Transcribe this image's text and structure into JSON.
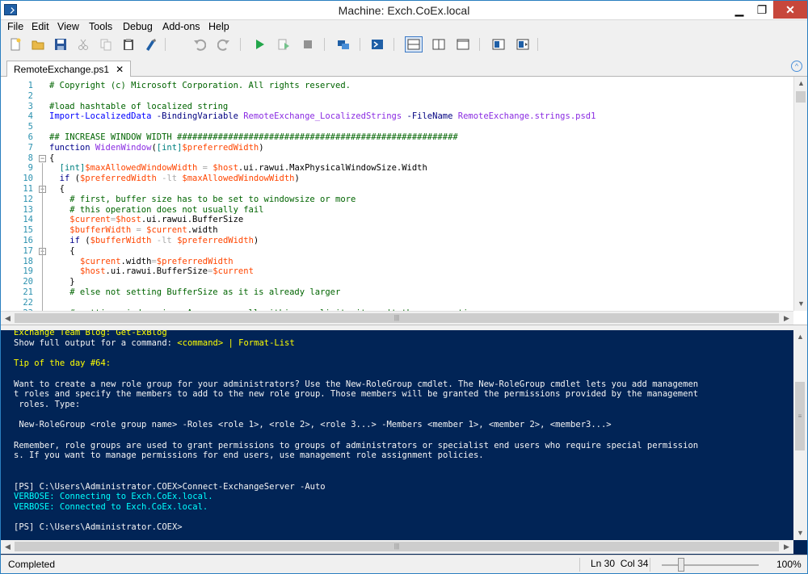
{
  "window": {
    "title": "Machine: Exch.CoEx.local",
    "minimize": "▁",
    "maximize": "❐",
    "close": "✕"
  },
  "menu": [
    "File",
    "Edit",
    "View",
    "Tools",
    "Debug",
    "Add-ons",
    "Help"
  ],
  "toolbar": {
    "icons": [
      "new-icon",
      "open-icon",
      "save-icon",
      "cut-icon",
      "copy-icon",
      "paste-icon",
      "clear-console-icon",
      "undo-icon",
      "redo-icon",
      "run-icon",
      "run-selection-icon",
      "stop-icon",
      "remote-session-icon",
      "powershell-icon",
      "layout-top-icon",
      "layout-right-icon",
      "layout-max-icon",
      "show-script-icon",
      "show-commands-icon"
    ]
  },
  "tab": {
    "label": "RemoteExchange.ps1",
    "close": "✕",
    "collapse": "^"
  },
  "editor": {
    "lines": [
      {
        "n": "1",
        "tokens": [
          {
            "c": "cm",
            "t": "# Copyright (c) Microsoft Corporation. All rights reserved."
          }
        ]
      },
      {
        "n": "2",
        "tokens": []
      },
      {
        "n": "3",
        "tokens": [
          {
            "c": "cm",
            "t": "#load hashtable of localized string"
          }
        ]
      },
      {
        "n": "4",
        "tokens": [
          {
            "c": "cmd",
            "t": "Import-LocalizedData"
          },
          {
            "c": "prm",
            "t": " -BindingVariable "
          },
          {
            "c": "str",
            "t": "RemoteExchange_LocalizedStrings"
          },
          {
            "c": "prm",
            "t": " -FileName "
          },
          {
            "c": "str",
            "t": "RemoteExchange.strings.psd1"
          }
        ]
      },
      {
        "n": "5",
        "tokens": []
      },
      {
        "n": "6",
        "tokens": [
          {
            "c": "cm",
            "t": "## INCREASE WINDOW WIDTH #######################################################"
          }
        ]
      },
      {
        "n": "7",
        "tokens": [
          {
            "c": "kw",
            "t": "function"
          },
          {
            "c": "plain",
            "t": " "
          },
          {
            "c": "str",
            "t": "WidenWindow"
          },
          {
            "c": "plain",
            "t": "("
          },
          {
            "c": "type",
            "t": "[int]"
          },
          {
            "c": "var",
            "t": "$preferredWidth"
          },
          {
            "c": "plain",
            "t": ")"
          }
        ]
      },
      {
        "n": "8",
        "tokens": [
          {
            "c": "plain",
            "t": "{"
          }
        ]
      },
      {
        "n": "9",
        "tokens": [
          {
            "c": "plain",
            "t": "  "
          },
          {
            "c": "type",
            "t": "[int]"
          },
          {
            "c": "var",
            "t": "$maxAllowedWindowWidth"
          },
          {
            "c": "op",
            "t": " = "
          },
          {
            "c": "var",
            "t": "$host"
          },
          {
            "c": "plain",
            "t": ".ui.rawui.MaxPhysicalWindowSize.Width"
          }
        ]
      },
      {
        "n": "10",
        "tokens": [
          {
            "c": "plain",
            "t": "  "
          },
          {
            "c": "kw",
            "t": "if"
          },
          {
            "c": "plain",
            "t": " ("
          },
          {
            "c": "var",
            "t": "$preferredWidth"
          },
          {
            "c": "op",
            "t": " -lt "
          },
          {
            "c": "var",
            "t": "$maxAllowedWindowWidth"
          },
          {
            "c": "plain",
            "t": ")"
          }
        ]
      },
      {
        "n": "11",
        "tokens": [
          {
            "c": "plain",
            "t": "  {"
          }
        ]
      },
      {
        "n": "12",
        "tokens": [
          {
            "c": "cm",
            "t": "    # first, buffer size has to be set to windowsize or more"
          }
        ]
      },
      {
        "n": "13",
        "tokens": [
          {
            "c": "cm",
            "t": "    # this operation does not usually fail"
          }
        ]
      },
      {
        "n": "14",
        "tokens": [
          {
            "c": "plain",
            "t": "    "
          },
          {
            "c": "var",
            "t": "$current"
          },
          {
            "c": "op",
            "t": "="
          },
          {
            "c": "var",
            "t": "$host"
          },
          {
            "c": "plain",
            "t": ".ui.rawui.BufferSize"
          }
        ]
      },
      {
        "n": "15",
        "tokens": [
          {
            "c": "plain",
            "t": "    "
          },
          {
            "c": "var",
            "t": "$bufferWidth"
          },
          {
            "c": "op",
            "t": " = "
          },
          {
            "c": "var",
            "t": "$current"
          },
          {
            "c": "plain",
            "t": ".width"
          }
        ]
      },
      {
        "n": "16",
        "tokens": [
          {
            "c": "plain",
            "t": "    "
          },
          {
            "c": "kw",
            "t": "if"
          },
          {
            "c": "plain",
            "t": " ("
          },
          {
            "c": "var",
            "t": "$bufferWidth"
          },
          {
            "c": "op",
            "t": " -lt "
          },
          {
            "c": "var",
            "t": "$preferredWidth"
          },
          {
            "c": "plain",
            "t": ")"
          }
        ]
      },
      {
        "n": "17",
        "tokens": [
          {
            "c": "plain",
            "t": "    {"
          }
        ]
      },
      {
        "n": "18",
        "tokens": [
          {
            "c": "plain",
            "t": "      "
          },
          {
            "c": "var",
            "t": "$current"
          },
          {
            "c": "plain",
            "t": ".width"
          },
          {
            "c": "op",
            "t": "="
          },
          {
            "c": "var",
            "t": "$preferredWidth"
          }
        ]
      },
      {
        "n": "19",
        "tokens": [
          {
            "c": "plain",
            "t": "      "
          },
          {
            "c": "var",
            "t": "$host"
          },
          {
            "c": "plain",
            "t": ".ui.rawui.BufferSize"
          },
          {
            "c": "op",
            "t": "="
          },
          {
            "c": "var",
            "t": "$current"
          }
        ]
      },
      {
        "n": "20",
        "tokens": [
          {
            "c": "plain",
            "t": "    }"
          }
        ]
      },
      {
        "n": "21",
        "tokens": [
          {
            "c": "cm",
            "t": "    # else not setting BufferSize as it is already larger"
          }
        ]
      },
      {
        "n": "22",
        "tokens": []
      },
      {
        "n": "23",
        "tokens": [
          {
            "c": "cm",
            "t": "    # setting window size. As we are well within max limit, it won't throw exception."
          }
        ]
      }
    ]
  },
  "console": {
    "lines": [
      {
        "c": "yel",
        "t": "Exchange Team Blog: Get-ExBlog"
      },
      {
        "c": "",
        "t": "Show full output for a command: ",
        "tail": "<command> | Format-List",
        "tailc": "yel"
      },
      {
        "c": "",
        "t": ""
      },
      {
        "c": "yel",
        "t": "Tip of the day #64:"
      },
      {
        "c": "",
        "t": ""
      },
      {
        "c": "",
        "t": "Want to create a new role group for your administrators? Use the New-RoleGroup cmdlet. The New-RoleGroup cmdlet lets you add managemen"
      },
      {
        "c": "",
        "t": "t roles and specify the members to add to the new role group. Those members will be granted the permissions provided by the management"
      },
      {
        "c": "",
        "t": " roles. Type:"
      },
      {
        "c": "",
        "t": ""
      },
      {
        "c": "",
        "t": " New-RoleGroup <role group name> -Roles <role 1>, <role 2>, <role 3...> -Members <member 1>, <member 2>, <member3...>"
      },
      {
        "c": "",
        "t": ""
      },
      {
        "c": "",
        "t": "Remember, role groups are used to grant permissions to groups of administrators or specialist end users who require special permission"
      },
      {
        "c": "",
        "t": "s. If you want to manage permissions for end users, use management role assignment policies."
      },
      {
        "c": "",
        "t": ""
      },
      {
        "c": "",
        "t": ""
      },
      {
        "c": "",
        "t": "[PS] C:\\Users\\Administrator.COEX>Connect-ExchangeServer -Auto"
      },
      {
        "c": "cyan",
        "t": "VERBOSE: Connecting to Exch.CoEx.local."
      },
      {
        "c": "cyan",
        "t": "VERBOSE: Connected to Exch.CoEx.local."
      },
      {
        "c": "",
        "t": ""
      },
      {
        "c": "",
        "t": "[PS] C:\\Users\\Administrator.COEX>"
      }
    ]
  },
  "status": {
    "text": "Completed",
    "line": "Ln 30",
    "col": "Col 34",
    "zoom": "100%",
    "zoom_level": 0.2
  }
}
